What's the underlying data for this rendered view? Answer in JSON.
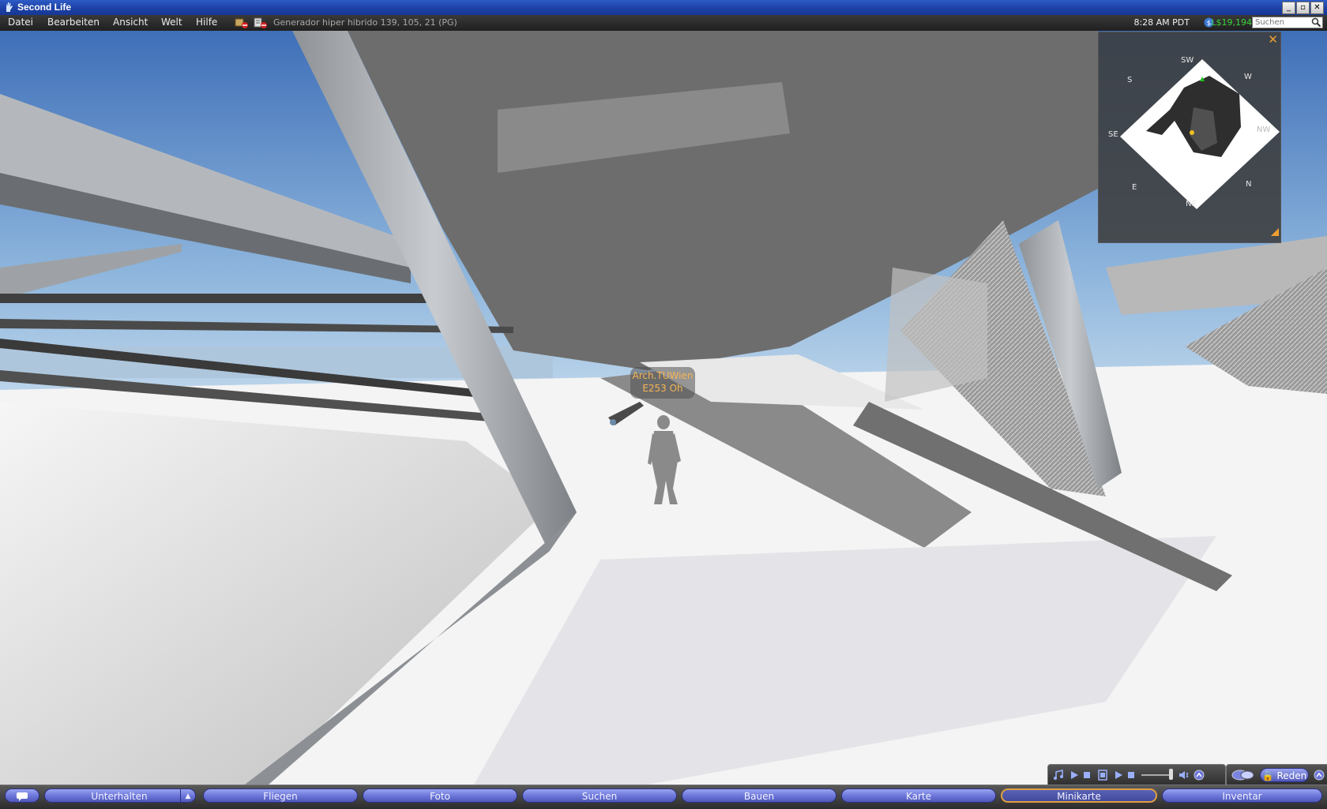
{
  "window": {
    "title": "Second Life",
    "minimize_label": "_",
    "maximize_label": "▫",
    "close_label": "✕"
  },
  "menu": {
    "items": [
      "Datei",
      "Bearbeiten",
      "Ansicht",
      "Welt",
      "Hilfe"
    ]
  },
  "status": {
    "location": "Generador hiper hibrido 139, 105, 21 (PG)",
    "time": "8:28 AM PDT",
    "balance": "L$19,194",
    "search_placeholder": "Suchen"
  },
  "nametag": {
    "line1": "Arch.TUWien",
    "line2": "E253 Oh"
  },
  "minimap": {
    "close_label": "✕",
    "directions": {
      "sw": "SW",
      "w": "W",
      "s": "S",
      "se": "SE",
      "nw": "NW",
      "e": "E",
      "n": "N",
      "ne": "NE"
    }
  },
  "toolbar": {
    "buttons": [
      "Unterhalten",
      "Fliegen",
      "Foto",
      "Suchen",
      "Bauen",
      "Karte",
      "Minikarte",
      "Inventar"
    ],
    "chat_expand_label": "▲"
  },
  "voice": {
    "talk_label": "Reden"
  },
  "colors": {
    "title_blue": "#1c3fa3",
    "balance_green": "#3ad43a",
    "button_blue": "#6a74d8",
    "active_border": "#e0a040",
    "nametag_orange": "#f6b455"
  }
}
